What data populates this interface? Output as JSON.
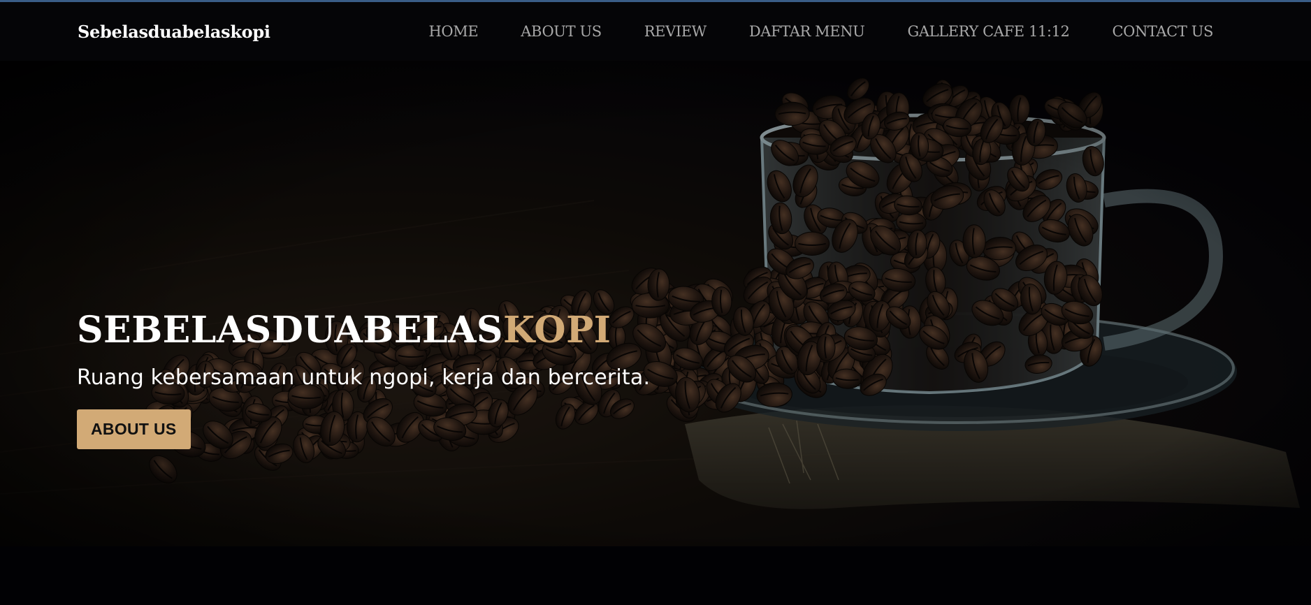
{
  "navbar": {
    "brand": "Sebelasduabelaskopi",
    "links": [
      {
        "label": "HOME"
      },
      {
        "label": "ABOUT US"
      },
      {
        "label": "REVIEW"
      },
      {
        "label": "DAFTAR MENU"
      },
      {
        "label": "GALLERY CAFE 11:12"
      },
      {
        "label": "CONTACT US"
      }
    ]
  },
  "hero": {
    "title_main": "SEBELASDUABELAS",
    "title_accent": "KOPI",
    "subtitle": "Ruang kebersamaan untuk ngopi, kerja dan bercerita.",
    "button_label": "ABOUT US",
    "background_image": "coffee-beans-glass-cup"
  },
  "colors": {
    "accent": "#d2aa76",
    "background": "#050507",
    "nav_text": "#a8a8a8",
    "top_border": "#3a5d86"
  }
}
